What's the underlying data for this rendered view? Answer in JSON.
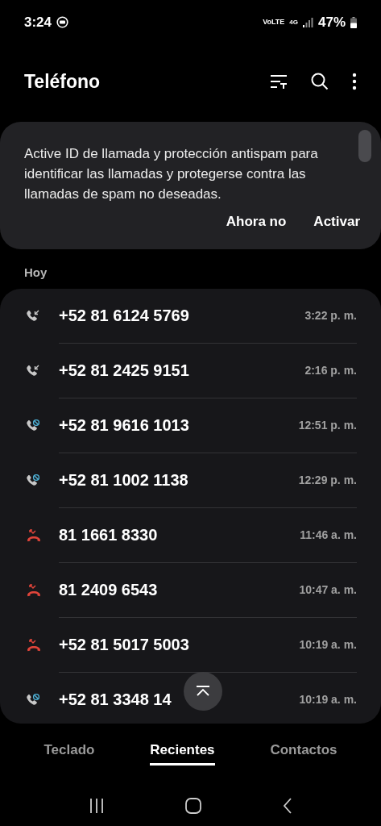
{
  "status_bar": {
    "time": "3:24",
    "battery": "47%",
    "network": "4G",
    "volte": "VoLTE"
  },
  "app_bar": {
    "title": "Teléfono"
  },
  "banner": {
    "message": "Active ID de llamada y protección antispam para identificar las llamadas y protegerse contra las llamadas de spam no deseadas.",
    "buttons": [
      "Ahora no",
      "Activar"
    ]
  },
  "section": "Hoy",
  "calls": [
    {
      "kind": "incoming",
      "number": "+52 81 6124 5769",
      "time": "3:22 p. m."
    },
    {
      "kind": "incoming",
      "number": "+52 81 2425 9151",
      "time": "2:16 p. m."
    },
    {
      "kind": "blocked",
      "number": "+52 81 9616 1013",
      "time": "12:51 p. m."
    },
    {
      "kind": "blocked",
      "number": "+52 81 1002 1138",
      "time": "12:29 p. m."
    },
    {
      "kind": "missed",
      "number": "81 1661 8330",
      "time": "11:46 a. m."
    },
    {
      "kind": "missed",
      "number": "81 2409 6543",
      "time": "10:47 a. m."
    },
    {
      "kind": "missed",
      "number": "+52 81 5017 5003",
      "time": "10:19 a. m."
    },
    {
      "kind": "blocked",
      "number": "+52 81 3348 14",
      "time": "10:19 a. m."
    }
  ],
  "tabs": [
    {
      "label": "Teclado",
      "selected": false
    },
    {
      "label": "Recientes",
      "selected": true
    },
    {
      "label": "Contactos",
      "selected": false
    }
  ]
}
